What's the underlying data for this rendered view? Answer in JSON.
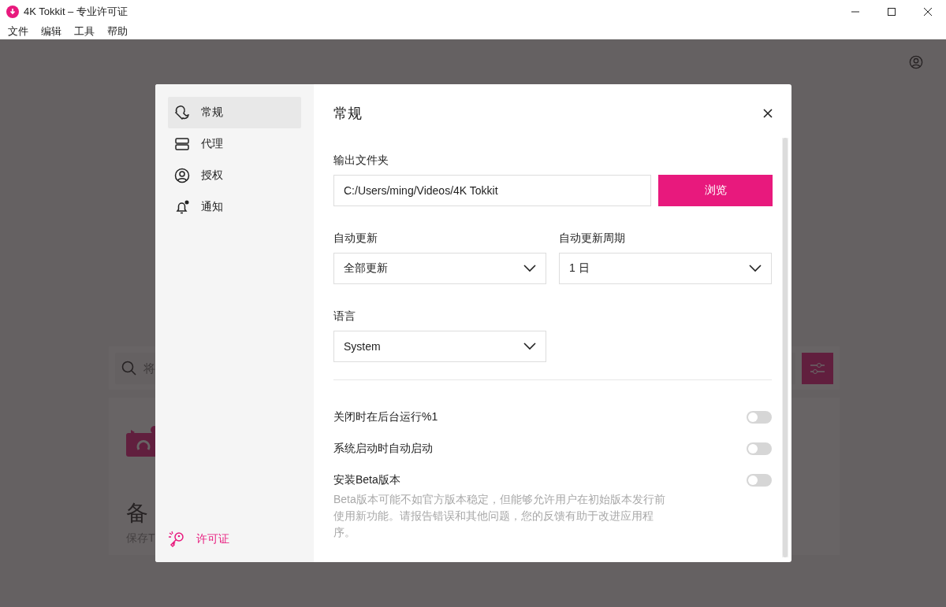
{
  "window": {
    "title": "4K Tokkit – 专业许可证"
  },
  "menu": [
    "文件",
    "编辑",
    "工具",
    "帮助"
  ],
  "background": {
    "search": {
      "placeholder": "将"
    },
    "card": {
      "title": "备",
      "subtitle": "保存T"
    }
  },
  "dialog": {
    "sidebar": {
      "items": [
        {
          "label": "常规",
          "selected": true
        },
        {
          "label": "代理",
          "selected": false
        },
        {
          "label": "授权",
          "selected": false
        },
        {
          "label": "通知",
          "selected": false
        }
      ],
      "footer_link": "许可证"
    },
    "title": "常规",
    "output_folder": {
      "label": "输出文件夹",
      "value": "C:/Users/ming/Videos/4K Tokkit",
      "button": "浏览"
    },
    "auto_update": {
      "label": "自动更新",
      "value": "全部更新"
    },
    "update_period": {
      "label": "自动更新周期",
      "value": "1 日"
    },
    "language": {
      "label": "语言",
      "value": "System"
    },
    "toggles": [
      {
        "label": "关闭时在后台运行%1",
        "on": false
      },
      {
        "label": "系统启动时自动启动",
        "on": false
      },
      {
        "label": "安装Beta版本",
        "on": false,
        "description": "Beta版本可能不如官方版本稳定，但能够允许用户在初始版本发行前使用新功能。请报告错误和其他问题，您的反馈有助于改进应用程序。"
      }
    ]
  }
}
